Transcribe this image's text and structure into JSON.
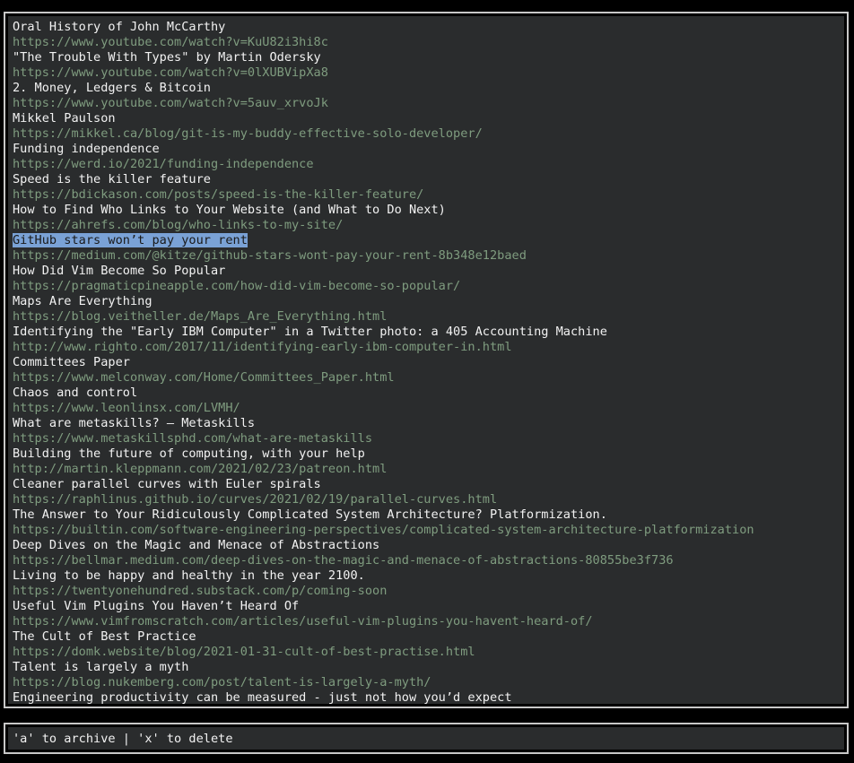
{
  "entries": [
    {
      "title": "Oral History of John McCarthy",
      "url": "https://www.youtube.com/watch?v=KuU82i3hi8c"
    },
    {
      "title": "\"The Trouble With Types\" by Martin Odersky",
      "url": "https://www.youtube.com/watch?v=0lXUBVipXa8"
    },
    {
      "title": "2. Money, Ledgers & Bitcoin",
      "url": "https://www.youtube.com/watch?v=5auv_xrvoJk"
    },
    {
      "title": "Mikkel Paulson",
      "url": "https://mikkel.ca/blog/git-is-my-buddy-effective-solo-developer/"
    },
    {
      "title": "Funding independence",
      "url": "https://werd.io/2021/funding-independence"
    },
    {
      "title": "Speed is the killer feature",
      "url": "https://bdickason.com/posts/speed-is-the-killer-feature/"
    },
    {
      "title": "How to Find Who Links to Your Website (and What to Do Next)",
      "url": "https://ahrefs.com/blog/who-links-to-my-site/"
    },
    {
      "title": "GitHub stars won’t pay your rent",
      "url": "https://medium.com/@kitze/github-stars-wont-pay-your-rent-8b348e12baed",
      "selected": true
    },
    {
      "title": "How Did Vim Become So Popular",
      "url": "https://pragmaticpineapple.com/how-did-vim-become-so-popular/"
    },
    {
      "title": "Maps Are Everything",
      "url": "https://blog.veitheller.de/Maps_Are_Everything.html"
    },
    {
      "title": "Identifying the \"Early IBM Computer\" in a Twitter photo: a 405 Accounting Machine",
      "url": "http://www.righto.com/2017/11/identifying-early-ibm-computer-in.html"
    },
    {
      "title": "Committees Paper",
      "url": "https://www.melconway.com/Home/Committees_Paper.html"
    },
    {
      "title": "Chaos and control",
      "url": "https://www.leonlinsx.com/LVMH/"
    },
    {
      "title": "What are metaskills? — Metaskills",
      "url": "https://www.metaskillsphd.com/what-are-metaskills"
    },
    {
      "title": "Building the future of computing, with your help",
      "url": "http://martin.kleppmann.com/2021/02/23/patreon.html"
    },
    {
      "title": "Cleaner parallel curves with Euler spirals",
      "url": "https://raphlinus.github.io/curves/2021/02/19/parallel-curves.html"
    },
    {
      "title": "The Answer to Your Ridiculously Complicated System Architecture? Platformization.",
      "url": "https://builtin.com/software-engineering-perspectives/complicated-system-architecture-platformization"
    },
    {
      "title": "Deep Dives on the Magic and Menace of Abstractions",
      "url": "https://bellmar.medium.com/deep-dives-on-the-magic-and-menace-of-abstractions-80855be3f736"
    },
    {
      "title": "Living to be happy and healthy in the year 2100.",
      "url": "https://twentyonehundred.substack.com/p/coming-soon"
    },
    {
      "title": "Useful Vim Plugins You Haven’t Heard Of",
      "url": "https://www.vimfromscratch.com/articles/useful-vim-plugins-you-havent-heard-of/"
    },
    {
      "title": "The Cult of Best Practice",
      "url": "https://domk.website/blog/2021-01-31-cult-of-best-practise.html"
    },
    {
      "title": "Talent is largely a myth",
      "url": "https://blog.nukemberg.com/post/talent-is-largely-a-myth/"
    },
    {
      "title": "Engineering productivity can be measured - just not how you’d expect",
      "url": ""
    }
  ],
  "footer": {
    "hint": "'a' to archive | 'x' to delete"
  },
  "colors": {
    "background": "#2a2c2d",
    "title": "#f2f2f2",
    "url": "#7f9c7f",
    "selection": "#7aa2d6",
    "border": "#c8c8c8"
  }
}
